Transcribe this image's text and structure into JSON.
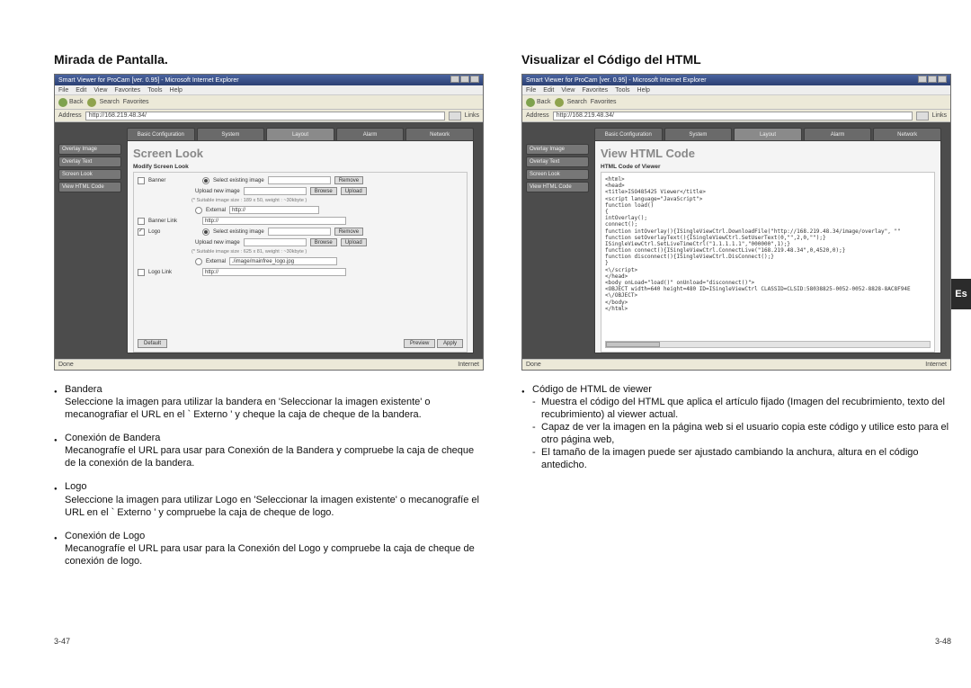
{
  "lang_tab": "Es",
  "left": {
    "title": "Mirada de Pantalla.",
    "page_num": "3-47",
    "browser": {
      "window_title": "Smart Viewer for ProCam [ver. 0.95] - Microsoft Internet Explorer",
      "menu": [
        "File",
        "Edit",
        "View",
        "Favorites",
        "Tools",
        "Help"
      ],
      "toolbar": {
        "back": "Back",
        "search": "Search",
        "favorites": "Favorites"
      },
      "address_label": "Address",
      "address": "http://168.219.48.34/",
      "go": "Go",
      "links": "Links",
      "status_left": "Done",
      "status_right": "Internet",
      "tabs": [
        "Basic Configuration",
        "System",
        "Layout",
        "Alarm",
        "Network"
      ],
      "active_tab": 2,
      "sidebar": [
        "Overlay Image",
        "Overlay Text",
        "Screen Look",
        "View HTML Code"
      ],
      "panel_title": "Screen Look",
      "panel_subhead": "Modify Screen Look",
      "fields": {
        "banner": "Banner",
        "select_existing": "Select existing image",
        "remove": "Remove",
        "upload_new": "Upload new image",
        "browse": "Browse",
        "upload": "Upload",
        "size_note_banner": "(* Suitable image size : 189 x 50, weight : ~30kbyte )",
        "external": "External",
        "http": "http://",
        "banner_link": "Banner Link",
        "logo": "Logo",
        "size_note_logo": "(* Suitable image size : 625 x 81, weight : ~30kbyte )",
        "external_path": "./image/mainfree_logo.jpg",
        "logo_link": "Logo Link",
        "default": "Default",
        "preview": "Preview",
        "apply": "Apply"
      }
    },
    "bullets": [
      {
        "head": "Bandera",
        "body": "Seleccione la imagen para utilizar la bandera en 'Seleccionar la imagen existente' o mecanografiar el URL en el ` Externo ' y cheque la caja de cheque de la bandera."
      },
      {
        "head": "Conexión de Bandera",
        "body": "Mecanografíe el URL para usar para Conexión de la Bandera y compruebe la caja de cheque de la conexión de la bandera."
      },
      {
        "head": "Logo",
        "body": "Seleccione la imagen para utilizar Logo en 'Seleccionar la imagen existente' o mecanografíe el URL en el ` Externo ' y compruebe la caja de cheque de logo."
      },
      {
        "head": "Conexión de Logo",
        "body": "Mecanografíe el URL para usar para la Conexión del Logo y compruebe la caja de cheque de conexión de logo."
      }
    ]
  },
  "right": {
    "title": "Visualizar el Código del HTML",
    "page_num": "3-48",
    "browser": {
      "window_title": "Smart Viewer for ProCam [ver. 0.95] - Microsoft Internet Explorer",
      "menu": [
        "File",
        "Edit",
        "View",
        "Favorites",
        "Tools",
        "Help"
      ],
      "toolbar": {
        "back": "Back",
        "search": "Search",
        "favorites": "Favorites"
      },
      "address_label": "Address",
      "address": "http://168.219.48.34/",
      "go": "Go",
      "links": "Links",
      "status_left": "Done",
      "status_right": "Internet",
      "tabs": [
        "Basic Configuration",
        "System",
        "Layout",
        "Alarm",
        "Network"
      ],
      "active_tab": 2,
      "sidebar": [
        "Overlay Image",
        "Overlay Text",
        "Screen Look",
        "View HTML Code"
      ],
      "panel_title": "View HTML Code",
      "panel_subhead": "HTML Code of Viewer",
      "code": "<html>\n<head>\n<title>ISO485425 Viewer</title>\n<script language=\"JavaScript\">\nfunction load()\n{\nintOverlay();\nconnect();\nfunction intOverlay(){ISingleViewCtrl.DownloadFile(\"http://168.219.48.34/image/overlay\", \"\"\nfunction setOverlayText(){ISingleViewCtrl.SetUserText(0,\"\",2,0,\"\");}\nISingleViewCtrl.SetLiveTimeCtrl(\"1.1.1.1.1\",\"000000\",1);}\nfunction connect(){ISingleViewCtrl.ConnectLive(\"168.219.48.34\",0,4520,0);}\nfunction disconnect(){ISingleViewCtrl.DisConnect();}\n}\n<\\/script>\n</head>\n<body onLoad=\"load()\" onUnload=\"disconnect()\">\n<OBJECT width=640 height=480 ID=ISingleViewCtrl CLASSID=CLSID:58038825-0052-0052-8828-8AC8F94E\n<\\/OBJECT>\n</body>\n</html>"
    },
    "bullets": [
      {
        "head": "Código de HTML de viewer",
        "subs": [
          "Muestra el código del HTML que aplica el artículo fijado (Imagen del recubrimiento, texto del recubrimiento) al viewer actual.",
          "Capaz de ver la imagen en la página web si el usuario copia este código y utilice esto para el otro página web,",
          "El tamaño de la imagen puede ser ajustado cambiando la anchura, altura en el código antedicho."
        ]
      }
    ]
  }
}
